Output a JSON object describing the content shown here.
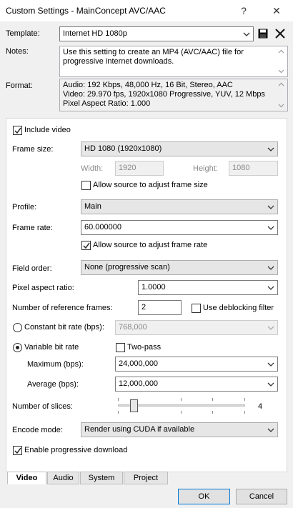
{
  "window": {
    "title": "Custom Settings - MainConcept AVC/AAC",
    "help": "?",
    "close": "✕"
  },
  "template": {
    "label": "Template:",
    "value": "Internet HD 1080p"
  },
  "notes": {
    "label": "Notes:",
    "text": "Use this setting to create an MP4 (AVC/AAC) file for progressive internet downloads."
  },
  "format": {
    "label": "Format:",
    "lines": [
      "Audio: 192 Kbps, 48,000 Hz, 16 Bit, Stereo, AAC",
      "Video: 29.970 fps, 1920x1080 Progressive, YUV, 12 Mbps",
      "Pixel Aspect Ratio: 1.000"
    ]
  },
  "video": {
    "include_video": {
      "label": "Include video",
      "checked": true
    },
    "frame_size": {
      "label": "Frame size:",
      "value": "HD 1080 (1920x1080)"
    },
    "width": {
      "label": "Width:",
      "value": "1920"
    },
    "height": {
      "label": "Height:",
      "value": "1080"
    },
    "allow_frame_size": {
      "label": "Allow source to adjust frame size",
      "checked": false
    },
    "profile": {
      "label": "Profile:",
      "value": "Main"
    },
    "frame_rate": {
      "label": "Frame rate:",
      "value": "60.000000"
    },
    "allow_frame_rate": {
      "label": "Allow source to adjust frame rate",
      "checked": true
    },
    "field_order": {
      "label": "Field order:",
      "value": "None (progressive scan)"
    },
    "pixel_aspect": {
      "label": "Pixel aspect ratio:",
      "value": "1.0000"
    },
    "ref_frames": {
      "label": "Number of reference frames:",
      "value": "2"
    },
    "deblocking": {
      "label": "Use deblocking filter",
      "checked": false
    },
    "cbr": {
      "label": "Constant bit rate (bps):",
      "value": "768,000",
      "selected": false
    },
    "vbr": {
      "label": "Variable bit rate",
      "selected": true
    },
    "two_pass": {
      "label": "Two-pass",
      "checked": false
    },
    "maximum": {
      "label": "Maximum (bps):",
      "value": "24,000,000"
    },
    "average": {
      "label": "Average (bps):",
      "value": "12,000,000"
    },
    "slices": {
      "label": "Number of slices:",
      "value": "4",
      "fraction": 0.1
    },
    "encode_mode": {
      "label": "Encode mode:",
      "value": "Render using CUDA if available"
    },
    "progressive_download": {
      "label": "Enable progressive download",
      "checked": true
    }
  },
  "tabs": [
    {
      "label": "Video",
      "active": true
    },
    {
      "label": "Audio",
      "active": false
    },
    {
      "label": "System",
      "active": false
    },
    {
      "label": "Project",
      "active": false
    }
  ],
  "buttons": {
    "ok": "OK",
    "cancel": "Cancel"
  },
  "colors": {
    "accent": "#0078d7",
    "panel": "#ffffff",
    "window": "#f0f0f0"
  }
}
